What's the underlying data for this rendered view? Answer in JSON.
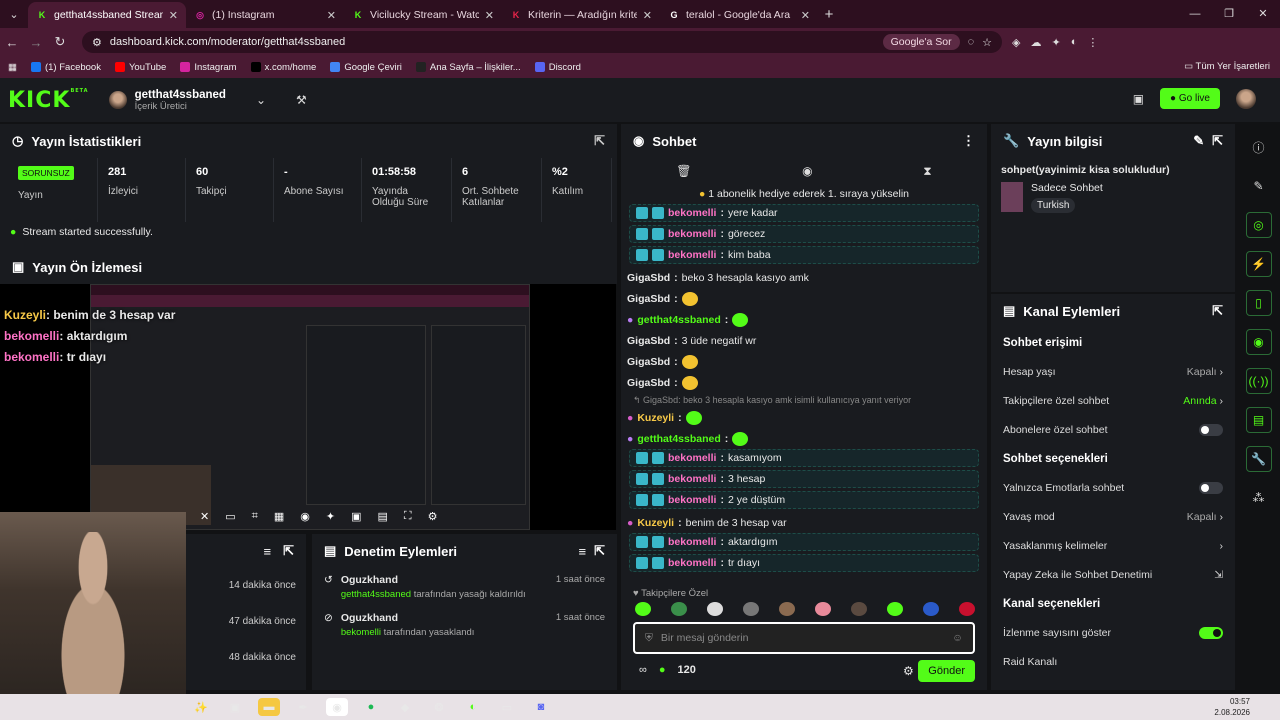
{
  "browser": {
    "tabs": [
      {
        "title": "getthat4ssbaned Stream - Kick",
        "active": true,
        "fav_color": "#53fc18",
        "fav": "K"
      },
      {
        "title": "(1) Instagram",
        "active": false,
        "fav_color": "#d6249f",
        "fav": "◎"
      },
      {
        "title": "Vicilucky Stream - Watch Live o",
        "active": false,
        "fav_color": "#53fc18",
        "fav": "K"
      },
      {
        "title": "Kriterin — Aradığın kriterlere",
        "active": false,
        "fav_color": "#e8254a",
        "fav": "K"
      },
      {
        "title": "teralol - Google'da Ara",
        "active": false,
        "fav_color": "#ffffff",
        "fav": "G"
      }
    ],
    "url": "dashboard.kick.com/moderator/getthat4ssbaned",
    "google_ask": "Google'a Sor",
    "bookmarks": [
      {
        "label": "(1) Facebook",
        "color": "#1877f2"
      },
      {
        "label": "YouTube",
        "color": "#ff0000"
      },
      {
        "label": "Instagram",
        "color": "#d6249f"
      },
      {
        "label": "x.com/home",
        "color": "#000000"
      },
      {
        "label": "Google Çeviri",
        "color": "#4285f4"
      },
      {
        "label": "Ana Sayfa – İlişkiler...",
        "color": "#222222"
      },
      {
        "label": "Discord",
        "color": "#5865f2"
      }
    ],
    "all_bookmarks": "Tüm Yer İşaretleri"
  },
  "header": {
    "logo": "KICK",
    "logo_beta": "BETA",
    "channel_name": "getthat4ssbaned",
    "channel_role": "İçerik Üretici",
    "go_live": "Go live"
  },
  "stats_panel": {
    "title": "Yayın İstatistikleri",
    "live_badge": "SORUNSUZ",
    "live_label": "Yayın",
    "stats": [
      {
        "value": "281",
        "label": "İzleyici"
      },
      {
        "value": "60",
        "label": "Takipçi"
      },
      {
        "value": "-",
        "label": "Abone Sayısı"
      },
      {
        "value": "01:58:58",
        "label": "Yayında Olduğu Süre"
      },
      {
        "value": "6",
        "label": "Ort. Sohbete Katılanlar"
      },
      {
        "value": "%2",
        "label": "Katılım"
      }
    ],
    "status_msg": "Stream started successfully."
  },
  "preview_panel": {
    "title": "Yayın Ön İzlemesi",
    "overlay_lines": [
      {
        "user": "Kuzeyli",
        "text": ": benim de 3 hesap var",
        "color": "#f7c948"
      },
      {
        "user": "bekomelli",
        "text": ": aktardıgım",
        "color": "#ff73c6"
      },
      {
        "user": "bekomelli",
        "text": ": tr dıayı",
        "color": "#ff73c6"
      }
    ]
  },
  "left_bottom": {
    "times": [
      "14 dakika önce",
      "47 dakika önce",
      "48 dakika önce"
    ]
  },
  "mod_actions": {
    "title": "Denetim Eylemleri",
    "items": [
      {
        "user": "Oguzkhand",
        "time": "1 saat önce",
        "target": "getthat4ssbaned",
        "action": "tarafından yasağı kaldırıldı"
      },
      {
        "user": "Oguzkhand",
        "time": "1 saat önce",
        "target": "bekomelli",
        "action": "tarafından yasaklandı"
      }
    ]
  },
  "chat": {
    "title": "Sohbet",
    "pinned": "1 abonelik hediye ederek 1. sıraya yükselin",
    "messages": [
      {
        "user": "bekomelli",
        "text": "yere kadar",
        "hl": true,
        "color": "#ff73c6"
      },
      {
        "user": "bekomelli",
        "text": "görecez",
        "hl": true,
        "color": "#ff73c6"
      },
      {
        "user": "bekomelli",
        "text": "kim baba",
        "hl": true,
        "color": "#ff73c6"
      },
      {
        "user": "GigaSbd",
        "text": "beko 3 hesapla kasıyo amk",
        "hl": false,
        "color": "#e8e8e8"
      },
      {
        "user": "GigaSbd",
        "text": "",
        "hl": false,
        "color": "#e8e8e8",
        "emote": "#f2c230"
      },
      {
        "user": "getthat4ssbaned",
        "text": "",
        "hl": false,
        "color": "#53fc18",
        "emote": "#53fc18"
      },
      {
        "user": "GigaSbd",
        "text": "3 üde negatif wr",
        "hl": false,
        "color": "#e8e8e8"
      },
      {
        "user": "GigaSbd",
        "text": "",
        "hl": false,
        "color": "#e8e8e8",
        "emote": "#f2c230"
      },
      {
        "user": "GigaSbd",
        "text": "",
        "hl": false,
        "color": "#e8e8e8",
        "emote": "#f2c230"
      }
    ],
    "reply_note": "GigaSbd: beko 3 hesapla kasıyo amk isimli kullanıcıya yanıt veriyor",
    "messages2": [
      {
        "user": "Kuzeyli",
        "text": "",
        "hl": false,
        "color": "#f7c948",
        "emote": "#53fc18"
      },
      {
        "user": "getthat4ssbaned",
        "text": "",
        "hl": false,
        "color": "#53fc18",
        "emote": "#53fc18"
      },
      {
        "user": "bekomelli",
        "text": "kasamıyom",
        "hl": true,
        "color": "#ff73c6"
      },
      {
        "user": "bekomelli",
        "text": "3 hesap",
        "hl": true,
        "color": "#ff73c6"
      },
      {
        "user": "bekomelli",
        "text": "2 ye düştüm",
        "hl": true,
        "color": "#ff73c6"
      },
      {
        "user": "Kuzeyli",
        "text": "benim de 3 hesap var",
        "hl": false,
        "color": "#f7c948"
      },
      {
        "user": "bekomelli",
        "text": "aktardıgım",
        "hl": true,
        "color": "#ff73c6"
      },
      {
        "user": "bekomelli",
        "text": "tr dıayı",
        "hl": true,
        "color": "#ff73c6"
      }
    ],
    "followers_only": "Takipçilere Özel",
    "input_placeholder": "Bir mesaj gönderin",
    "points": "120",
    "send": "Gönder"
  },
  "stream_info": {
    "title": "Yayın bilgisi",
    "stream_title": "sohpet(yayinimiz kisa solukludur)",
    "category": "Sadece Sohbet",
    "language": "Turkish"
  },
  "channel_actions": {
    "title": "Kanal Eylemleri",
    "chat_access": "Sohbet erişimi",
    "account_age": "Hesap yaşı",
    "account_age_value": "Kapalı",
    "followers_chat": "Takipçilere özel sohbet",
    "followers_chat_value": "Anında",
    "subs_chat": "Abonelere özel sohbet",
    "chat_options": "Sohbet seçenekleri",
    "emote_only": "Yalnızca Emotlarla sohbet",
    "slow_mode": "Yavaş mod",
    "slow_mode_value": "Kapalı",
    "banned_words": "Yasaklanmış kelimeler",
    "ai_mod": "Yapay Zeka ile Sohbet Denetimi",
    "channel_options": "Kanal seçenekleri",
    "show_viewers": "İzlenme sayısını göster",
    "raid": "Raid Kanalı"
  },
  "taskbar": {
    "time": "03:57",
    "date": "2.08.2026"
  }
}
